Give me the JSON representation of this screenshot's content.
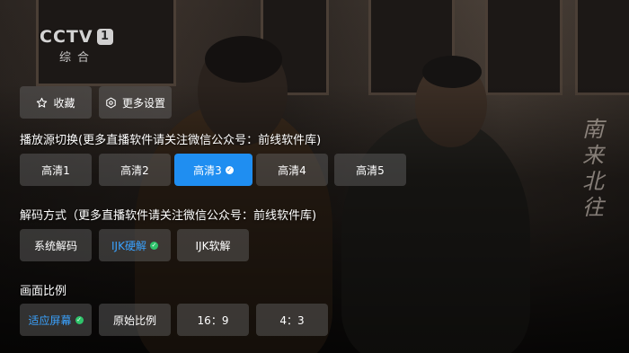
{
  "channel": {
    "brand": "CCTV",
    "number": "1",
    "subtitle": "综合"
  },
  "watermark": "南来北往",
  "top_buttons": [
    {
      "label": "收藏",
      "icon": "star-icon"
    },
    {
      "label": "更多设置",
      "icon": "gear-icon"
    }
  ],
  "source_section": {
    "title": "播放源切换(更多直播软件请关注微信公众号：前线软件库)",
    "options": [
      {
        "label": "高清1",
        "selected": false
      },
      {
        "label": "高清2",
        "selected": false
      },
      {
        "label": "高清3",
        "selected": true
      },
      {
        "label": "高清4",
        "selected": false
      },
      {
        "label": "高清5",
        "selected": false
      }
    ]
  },
  "decode_section": {
    "title": "解码方式（更多直播软件请关注微信公众号：前线软件库)",
    "options": [
      {
        "label": "系统解码",
        "selected": false
      },
      {
        "label": "IJK硬解",
        "selected": true
      },
      {
        "label": "IJK软解",
        "selected": false
      }
    ]
  },
  "ratio_section": {
    "title": "画面比例",
    "options": [
      {
        "label": "适应屏幕",
        "selected": true
      },
      {
        "label": "原始比例",
        "selected": false
      },
      {
        "label": "16：9",
        "selected": false
      },
      {
        "label": "4：3",
        "selected": false
      }
    ]
  },
  "colors": {
    "accent_blue": "#1f8ef1",
    "selected_text_blue": "#3aa2ff",
    "check_green": "#2fc46b",
    "button_bg": "rgba(110,110,110,0.42)"
  }
}
